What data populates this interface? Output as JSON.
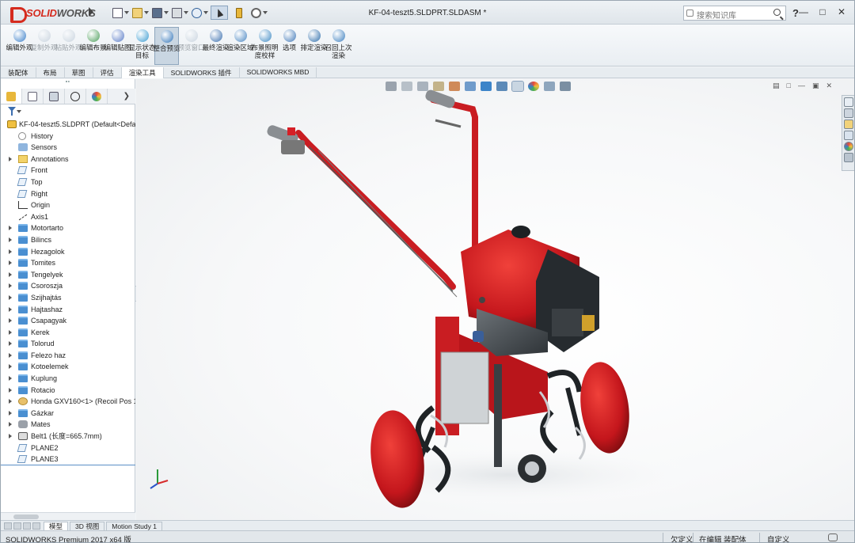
{
  "app": {
    "brand_ds": "DS",
    "brand_solid": "SOLID",
    "brand_works": "WORKS",
    "document_title": "KF-04-teszt5.SLDPRT.SLDASM *"
  },
  "search": {
    "placeholder": "搜索知识库"
  },
  "help_glyph": "?",
  "ribbon": {
    "buttons": [
      {
        "label": "编辑外观",
        "color": "#3a7fc9",
        "disabled": false,
        "selected": false
      },
      {
        "label": "复制外观",
        "color": "#8fa5bb",
        "disabled": true,
        "selected": false
      },
      {
        "label": "粘贴外观",
        "color": "#8fa5bb",
        "disabled": true,
        "selected": false
      },
      {
        "label": "编辑布景",
        "color": "#4c9e5a",
        "disabled": false,
        "selected": false
      },
      {
        "label": "编辑贴图",
        "color": "#5a7cc7",
        "disabled": false,
        "selected": false
      },
      {
        "label": "显示状态目标",
        "color": "#3a9bd1",
        "disabled": false,
        "selected": false
      },
      {
        "label": "整合预览",
        "color": "#2f73b8",
        "disabled": false,
        "selected": true
      },
      {
        "label": "预览窗口",
        "color": "#8fa5bb",
        "disabled": true,
        "selected": false
      },
      {
        "label": "最终渲染",
        "color": "#3b6fae",
        "disabled": false,
        "selected": false
      },
      {
        "label": "渲染区域",
        "color": "#4a86c2",
        "disabled": false,
        "selected": false
      },
      {
        "label": "布景照明度校样",
        "color": "#3f8ac4",
        "disabled": false,
        "selected": false
      },
      {
        "label": "选项",
        "color": "#4179b8",
        "disabled": false,
        "selected": false
      },
      {
        "label": "排定渲染",
        "color": "#2f6eab",
        "disabled": false,
        "selected": false
      },
      {
        "label": "召回上次渲染",
        "color": "#3c7fbf",
        "disabled": false,
        "selected": false
      }
    ]
  },
  "command_tabs": [
    "装配体",
    "布局",
    "草图",
    "评估",
    "渲染工具",
    "SOLIDWORKS 插件",
    "SOLIDWORKS MBD"
  ],
  "active_command_tab": "渲染工具",
  "tree": {
    "root": "KF-04-teszt5.SLDPRT  (Default<Default",
    "items": [
      {
        "label": "History",
        "icon": "history-icon",
        "expandable": false
      },
      {
        "label": "Sensors",
        "icon": "sensor-icon",
        "expandable": false
      },
      {
        "label": "Annotations",
        "icon": "annotation-icon",
        "expandable": true
      },
      {
        "label": "Front",
        "icon": "plane-icon",
        "expandable": false
      },
      {
        "label": "Top",
        "icon": "plane-icon",
        "expandable": false
      },
      {
        "label": "Right",
        "icon": "plane-icon",
        "expandable": false
      },
      {
        "label": "Origin",
        "icon": "origin-icon",
        "expandable": false
      },
      {
        "label": "Axis1",
        "icon": "axis-icon",
        "expandable": false
      },
      {
        "label": "Motortarto",
        "icon": "folder-icon",
        "expandable": true
      },
      {
        "label": "Bilincs",
        "icon": "folder-icon",
        "expandable": true
      },
      {
        "label": "Hezagolok",
        "icon": "folder-icon",
        "expandable": true
      },
      {
        "label": "Tomites",
        "icon": "folder-icon",
        "expandable": true
      },
      {
        "label": "Tengelyek",
        "icon": "folder-icon",
        "expandable": true
      },
      {
        "label": "Csoroszja",
        "icon": "folder-icon",
        "expandable": true
      },
      {
        "label": "Szijhajtás",
        "icon": "folder-icon",
        "expandable": true
      },
      {
        "label": "Hajtashaz",
        "icon": "folder-icon",
        "expandable": true
      },
      {
        "label": "Csapagyak",
        "icon": "folder-icon",
        "expandable": true
      },
      {
        "label": "Kerek",
        "icon": "folder-icon",
        "expandable": true
      },
      {
        "label": "Tolorud",
        "icon": "folder-icon",
        "expandable": true
      },
      {
        "label": "Felezo haz",
        "icon": "folder-icon",
        "expandable": true
      },
      {
        "label": "Kotoelemek",
        "icon": "folder-icon",
        "expandable": true
      },
      {
        "label": "Kuplung",
        "icon": "folder-icon",
        "expandable": true
      },
      {
        "label": "Rotacio",
        "icon": "folder-icon",
        "expandable": true
      },
      {
        "label": "Honda GXV160<1> (Recoil Pos 1-",
        "icon": "part-icon",
        "expandable": true
      },
      {
        "label": "Gázkar",
        "icon": "folder-icon",
        "expandable": true
      },
      {
        "label": "Mates",
        "icon": "mates-icon",
        "expandable": true
      },
      {
        "label": "Belt1 (长度=665.7mm)",
        "icon": "belt-icon",
        "expandable": true
      },
      {
        "label": "PLANE2",
        "icon": "plane-icon",
        "expandable": false
      },
      {
        "label": "PLANE3",
        "icon": "plane-icon",
        "expandable": false
      }
    ]
  },
  "bottom_tabs": [
    "模型",
    "3D 视图",
    "Motion Study 1"
  ],
  "active_bottom_tab": "模型",
  "status": {
    "product": "SOLIDWORKS Premium 2017 x64 版",
    "defined_state": "欠定义",
    "editing": "在编辑 装配体",
    "units": "自定义"
  }
}
